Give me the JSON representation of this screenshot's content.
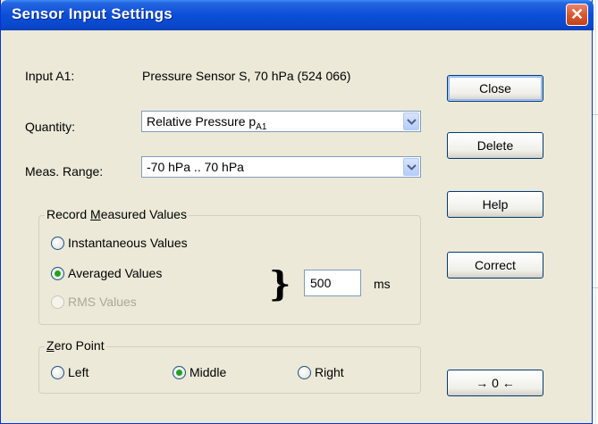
{
  "window": {
    "title": "Sensor Input Settings",
    "close_glyph": "✕"
  },
  "input": {
    "label": "Input A1:",
    "value": "Pressure Sensor S, 70 hPa (524 066)"
  },
  "quantity": {
    "label": "Quantity:",
    "value_main": "Relative Pressure p",
    "value_sub": "A1"
  },
  "range": {
    "label": "Meas. Range:",
    "value": "-70 hPa .. 70 hPa"
  },
  "record": {
    "legend_pre": "Record ",
    "legend_mnemonic": "M",
    "legend_post": "easured Values",
    "options": [
      {
        "label": "Instantaneous Values",
        "selected": false,
        "enabled": true
      },
      {
        "label": "Averaged Values",
        "selected": true,
        "enabled": true
      },
      {
        "label": "RMS Values",
        "selected": false,
        "enabled": false
      }
    ],
    "interval_value": "500",
    "interval_unit": "ms",
    "brace": "}"
  },
  "zero_point": {
    "legend_mnemonic": "Z",
    "legend_post": "ero Point",
    "options": [
      {
        "label": "Left",
        "selected": false
      },
      {
        "label": "Middle",
        "selected": true
      },
      {
        "label": "Right",
        "selected": false
      }
    ]
  },
  "buttons": {
    "close": "Close",
    "delete": "Delete",
    "help": "Help",
    "correct": "Correct",
    "zero": "→ 0 ←"
  },
  "colors": {
    "title_bar": "#0a4fd8",
    "dialog_bg": "#ece9d8",
    "radio_selected": "#21a121"
  }
}
